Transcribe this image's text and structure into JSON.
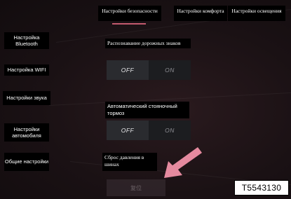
{
  "sidebar": {
    "items": [
      {
        "label": "Настройка Bluetooth"
      },
      {
        "label": "Настройка WIFI"
      },
      {
        "label": "Настройки звука"
      },
      {
        "label": "Настройки автомобиля"
      },
      {
        "label": "Общие настройки"
      }
    ]
  },
  "tabs": [
    {
      "label": "Настройки безопасности",
      "active": true
    },
    {
      "label": "Настройки комфорта",
      "active": false
    },
    {
      "label": "Настройки освещения",
      "active": false
    }
  ],
  "settings": {
    "traffic_sign": {
      "label": "Распознавание дорожных знаков",
      "off_label": "OFF",
      "on_label": "ON",
      "state": "OFF"
    },
    "parking_brake": {
      "label": "Автоматический стояночный тормоз",
      "off_label": "OFF",
      "on_label": "ON",
      "state": "OFF"
    },
    "tire_reset": {
      "label": "Сброс давления в шинах",
      "button_label": "复位"
    }
  },
  "image_code": "T5543130",
  "colors": {
    "accent": "#c35a6e",
    "arrow": "#e58a9f",
    "toggle_active": "#2a2b2f",
    "toggle_inactive": "#1c1d20"
  }
}
